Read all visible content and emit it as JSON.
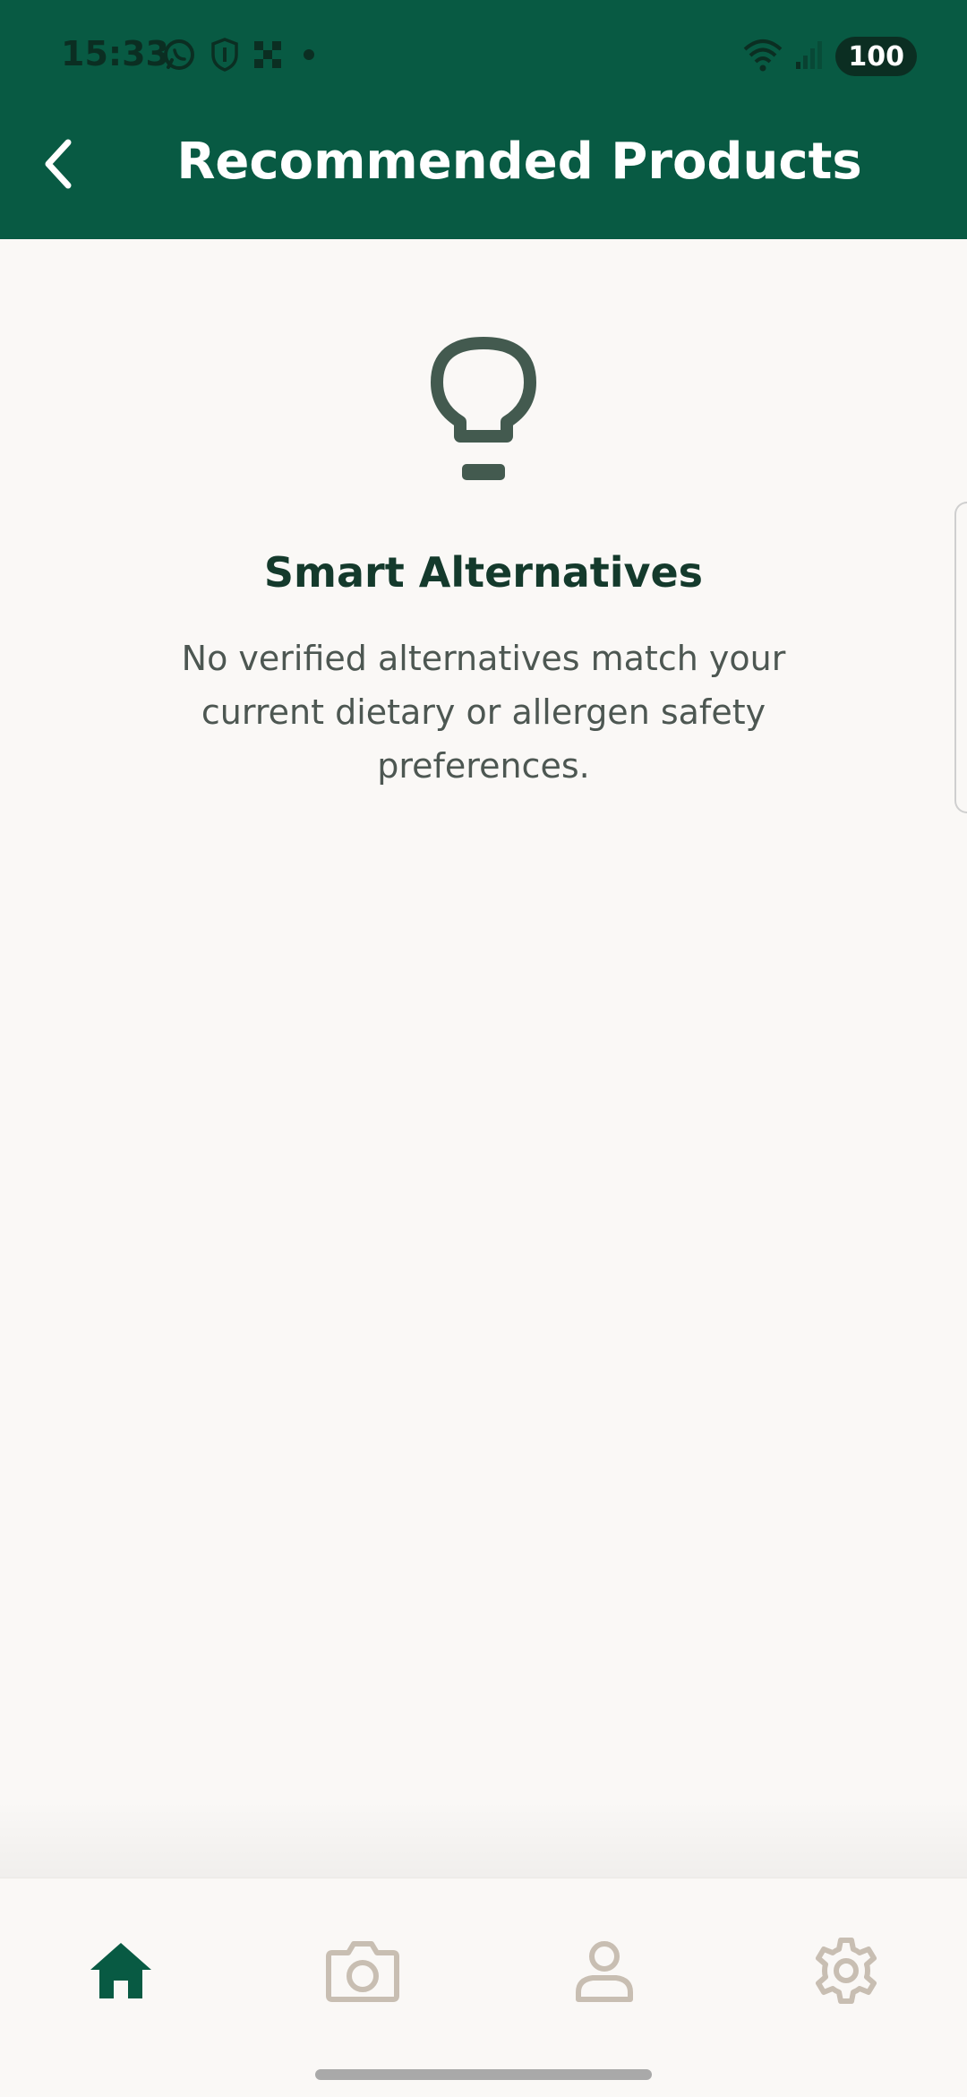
{
  "status_bar": {
    "time": "15:33",
    "battery": "100",
    "icons_left": [
      "whatsapp-icon",
      "shield-icon",
      "qr-icon",
      "dot-icon"
    ],
    "icons_right": [
      "wifi-icon",
      "signal-icon",
      "battery-icon"
    ]
  },
  "header": {
    "title": "Recommended Products",
    "back_icon": "chevron-left-icon"
  },
  "empty_state": {
    "icon": "lightbulb-icon",
    "title": "Smart Alternatives",
    "message": "No verified alternatives match your current dietary or allergen safety preferences."
  },
  "bottom_nav": {
    "items": [
      {
        "icon": "home-icon",
        "active": true
      },
      {
        "icon": "camera-icon",
        "active": false
      },
      {
        "icon": "profile-icon",
        "active": false
      },
      {
        "icon": "settings-icon",
        "active": false
      }
    ]
  },
  "colors": {
    "primary": "#085a43",
    "text_dark": "#143a2c",
    "text_muted": "#4d5752",
    "icon_inactive": "#c8beb2",
    "background": "#faf8f6"
  }
}
